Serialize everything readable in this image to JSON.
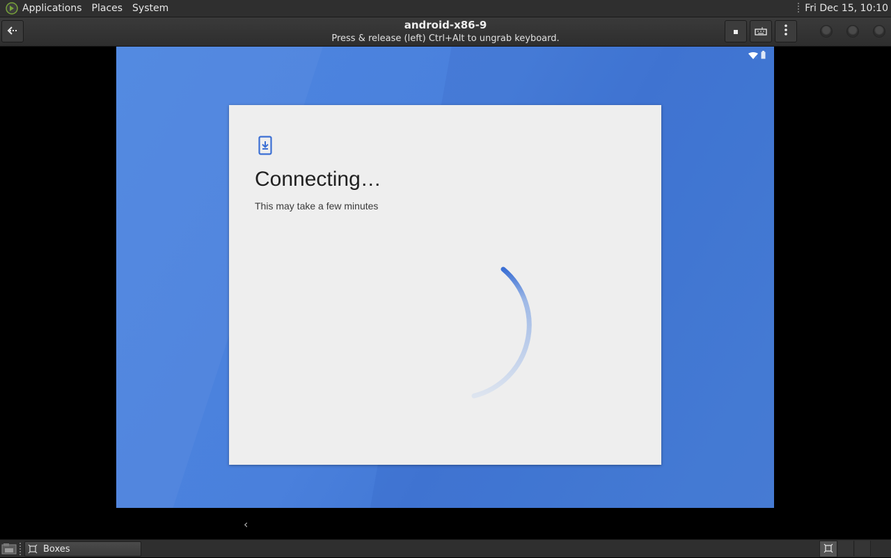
{
  "top_panel": {
    "menus": [
      "Applications",
      "Places",
      "System"
    ],
    "clock": "Fri Dec 15, 10:10",
    "logo_icon": "distro-logo-icon"
  },
  "header": {
    "title": "android-x86-9",
    "subtitle": "Press & release (left) Ctrl+Alt to ungrab keyboard.",
    "back_icon": "back-arrow-icon",
    "buttons": [
      "stop-icon",
      "keyboard-icon",
      "menu-kebab-icon"
    ],
    "window_controls": [
      "minimize",
      "maximize",
      "close"
    ]
  },
  "android": {
    "background_color": "#4a80dc",
    "status_icons": [
      "wifi-icon",
      "battery-icon"
    ],
    "card": {
      "icon": "phone-download-icon",
      "title": "Connecting…",
      "subtitle": "This may take a few minutes"
    },
    "accent": "#3b6fd4"
  },
  "taskbar": {
    "task_label": "Boxes",
    "workspaces": 3,
    "active_workspace": 1
  }
}
